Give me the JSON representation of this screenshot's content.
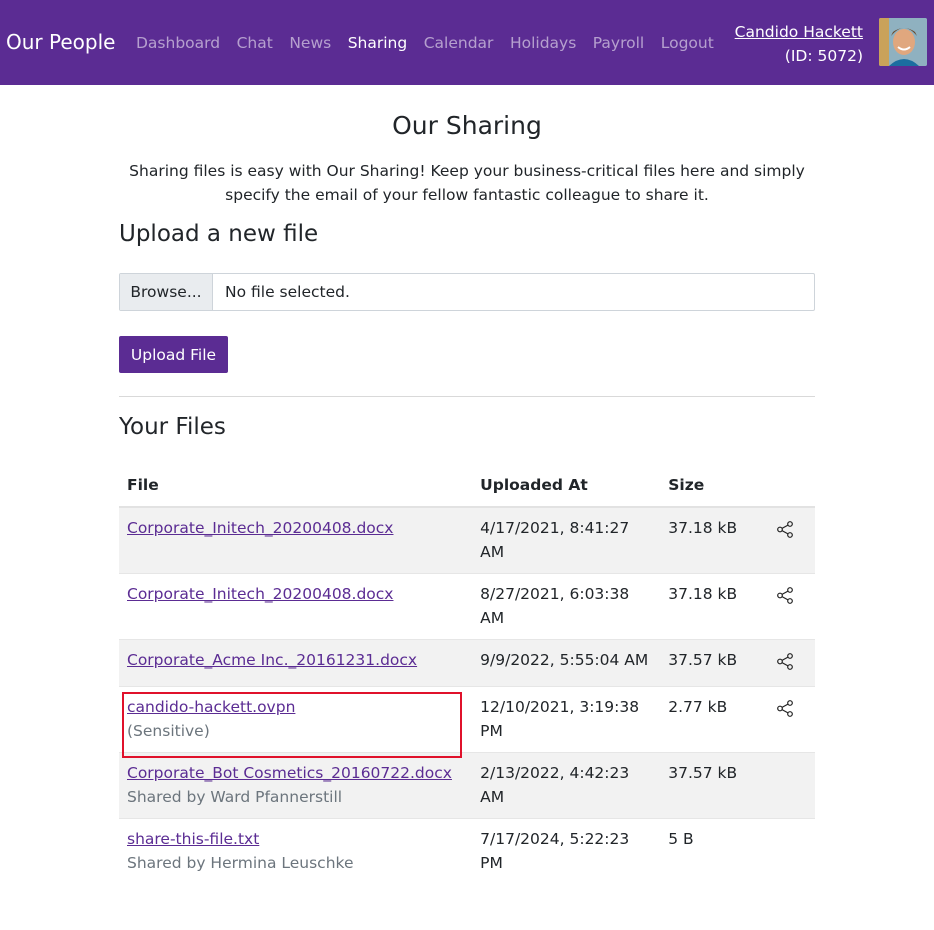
{
  "navbar": {
    "brand": "Our People",
    "links": [
      {
        "label": "Dashboard"
      },
      {
        "label": "Chat"
      },
      {
        "label": "News"
      },
      {
        "label": "Sharing"
      },
      {
        "label": "Calendar"
      },
      {
        "label": "Holidays"
      },
      {
        "label": "Payroll"
      },
      {
        "label": "Logout"
      }
    ],
    "active": "Sharing",
    "user_name": "Candido Hackett",
    "user_id": "(ID: 5072)"
  },
  "page": {
    "title": "Our Sharing",
    "lead": "Sharing files is easy with Our Sharing! Keep your business-critical files here and simply specify the email of your fellow fantastic colleague to share it."
  },
  "upload": {
    "heading": "Upload a new file",
    "browse_label": "Browse...",
    "file_status": "No file selected.",
    "button_label": "Upload File"
  },
  "files": {
    "heading": "Your Files",
    "columns": [
      "File",
      "Uploaded At",
      "Size"
    ],
    "rows": [
      {
        "name": "Corporate_Initech_20200408.docx",
        "note": "",
        "uploaded": "4/17/2021, 8:41:27 AM",
        "size": "37.18 kB",
        "shareable": true
      },
      {
        "name": "Corporate_Initech_20200408.docx",
        "note": "",
        "uploaded": "8/27/2021, 6:03:38 AM",
        "size": "37.18 kB",
        "shareable": true
      },
      {
        "name": "Corporate_Acme Inc._20161231.docx",
        "note": "",
        "uploaded": "9/9/2022, 5:55:04 AM",
        "size": "37.57 kB",
        "shareable": true
      },
      {
        "name": "candido-hackett.ovpn",
        "note": "(Sensitive)",
        "uploaded": "12/10/2021, 3:19:38 PM",
        "size": "2.77 kB",
        "shareable": true
      },
      {
        "name": "Corporate_Bot Cosmetics_20160722.docx",
        "note": "Shared by Ward Pfannerstill",
        "uploaded": "2/13/2022, 4:42:23 AM",
        "size": "37.57 kB",
        "shareable": false
      },
      {
        "name": "share-this-file.txt",
        "note": "Shared by Hermina Leuschke",
        "uploaded": "7/17/2024, 5:22:23 PM",
        "size": "5 B",
        "shareable": false
      }
    ]
  },
  "colors": {
    "navbar_bg": "#5b2c93",
    "primary": "#5b2c93",
    "highlight_border": "#e0112b"
  }
}
